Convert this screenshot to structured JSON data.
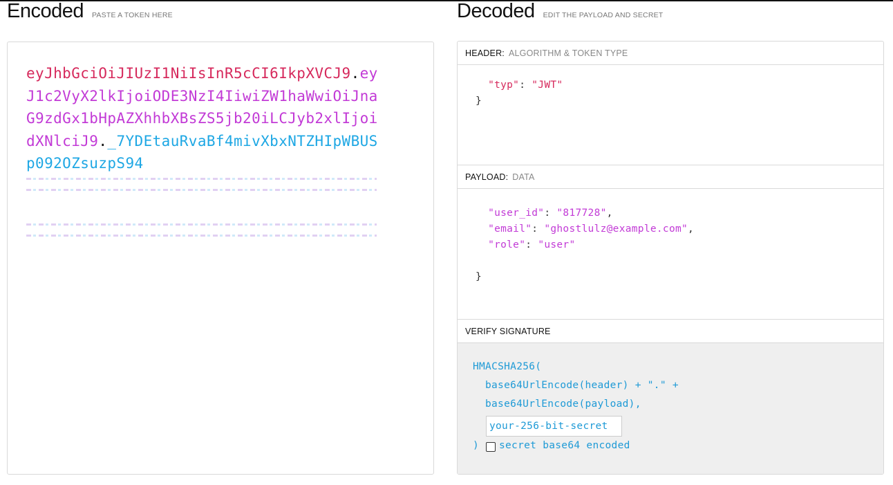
{
  "encoded": {
    "title": "Encoded",
    "subtitle": "PASTE A TOKEN HERE",
    "token_header": "eyJhbGciOiJIUzI1NiIsInR5cCI6IkpXVCJ9",
    "token_payload": "eyJ1c2VyX2lkIjoiODE3NzI4IiwiZW1haWwiOiJnaG9zdGx1bHpAZXhhbXBsZS5jb20iLCJyb2xlIjoidXNlciJ9",
    "token_signature": "_7YDEtauRvaBf4mivXbxNTZHIpWBUSp092OZsuzpS94",
    "dot": "."
  },
  "decoded": {
    "title": "Decoded",
    "subtitle": "EDIT THE PAYLOAD AND SECRET",
    "header_section": {
      "label": "HEADER:",
      "hint": "ALGORITHM & TOKEN TYPE"
    },
    "header_lines": {
      "typ_key": "\"typ\"",
      "typ_val": "\"JWT\"",
      "close": "}"
    },
    "payload_section": {
      "label": "PAYLOAD:",
      "hint": "DATA"
    },
    "payload_lines": {
      "user_id_key": "\"user_id\"",
      "user_id_val": "\"817728\"",
      "email_key": "\"email\"",
      "email_val": "\"ghostlulz@example.com\"",
      "role_key": "\"role\"",
      "role_val": "\"user\"",
      "close": "}"
    },
    "verify_section": {
      "label": "VERIFY SIGNATURE"
    },
    "verify": {
      "line1": "HMACSHA256(",
      "line2": "base64UrlEncode(header) + \".\" +",
      "line3": "base64UrlEncode(payload),",
      "secret_placeholder": "your-256-bit-secret",
      "close_paren": ")",
      "checkbox_label": "secret base64 encoded"
    }
  },
  "colors": {
    "header": "#d6295c",
    "payload": "#c23ad6",
    "signature": "#1ea7e4"
  }
}
